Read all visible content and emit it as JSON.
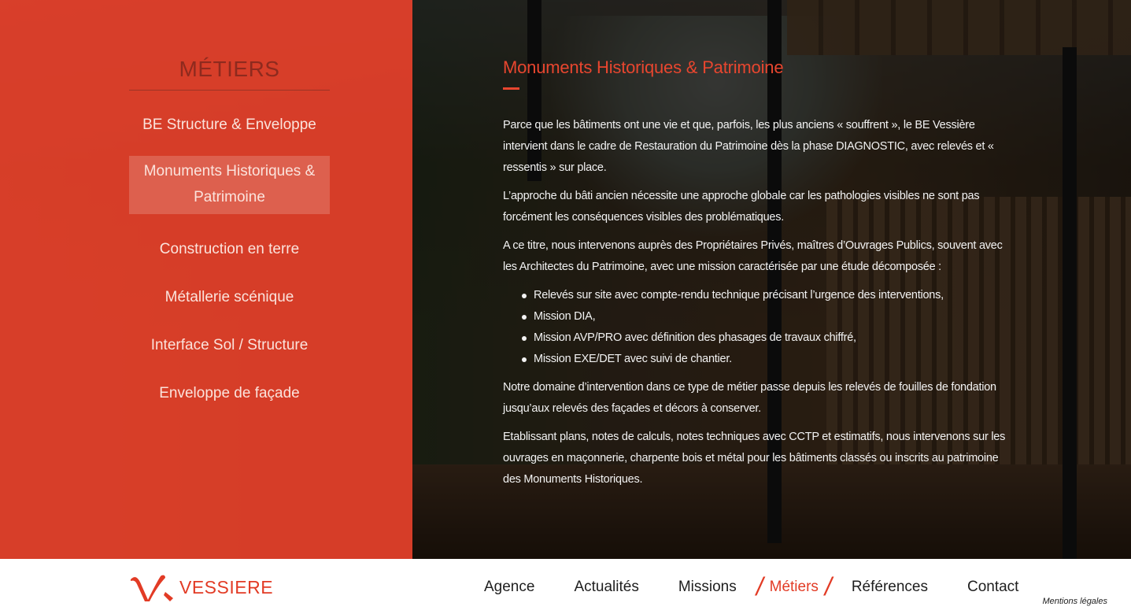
{
  "side": {
    "title": "MÉTIERS",
    "items": [
      {
        "label": "BE Structure & Enveloppe",
        "active": false
      },
      {
        "label": "Monuments Historiques & Patrimoine",
        "active": true
      },
      {
        "label": "Construction en terre",
        "active": false
      },
      {
        "label": "Métallerie scénique",
        "active": false
      },
      {
        "label": "Interface Sol / Structure",
        "active": false
      },
      {
        "label": "Enveloppe de façade",
        "active": false
      }
    ]
  },
  "content": {
    "title": "Monuments Historiques & Patrimoine",
    "paragraphs": [
      "Parce que les bâtiments ont une vie et que, parfois, les plus anciens « souffrent », le BE Vessière intervient dans le cadre de Restauration du Patrimoine dès la phase DIAGNOSTIC, avec relevés et « ressentis » sur place.",
      "L’approche du bâti ancien nécessite une approche globale car les pathologies visibles ne sont pas forcément les conséquences visibles des problématiques.",
      "A ce titre, nous intervenons auprès des Propriétaires Privés, maîtres d’Ouvrages Publics, souvent avec les Architectes du Patrimoine, avec une mission caractérisée par une étude décomposée :"
    ],
    "bullets": [
      "Relevés sur site avec compte-rendu technique précisant l’urgence des interventions,",
      "Mission DIA,",
      "Mission AVP/PRO avec définition des phasages de travaux chiffré,",
      "Mission EXE/DET avec suivi de chantier."
    ],
    "paragraphs_after": [
      "Notre domaine d’intervention dans ce type de métier passe depuis les relevés de fouilles de fondation jusqu’aux relevés des façades et décors à conserver.",
      "Etablissant plans, notes de calculs, notes techniques avec CCTP et estimatifs, nous intervenons sur les ouvrages en maçonnerie, charpente bois et métal pour les bâtiments classés ou inscrits au patrimoine des Monuments Historiques."
    ]
  },
  "footer": {
    "logo_text": "VESSIERE",
    "nav": [
      {
        "label": "Agence",
        "active": false
      },
      {
        "label": "Actualités",
        "active": false
      },
      {
        "label": "Missions",
        "active": false
      },
      {
        "label": "Métiers",
        "active": true
      },
      {
        "label": "Références",
        "active": false
      },
      {
        "label": "Contact",
        "active": false
      }
    ],
    "legal": "Mentions légales"
  },
  "colors": {
    "brand_red": "#e23b25",
    "title_red": "#e8462f",
    "panel_title": "#8e2a1e"
  },
  "icons": {
    "logo": "vessiere-v-logo-icon",
    "bullet": "bullet-dot-icon"
  }
}
